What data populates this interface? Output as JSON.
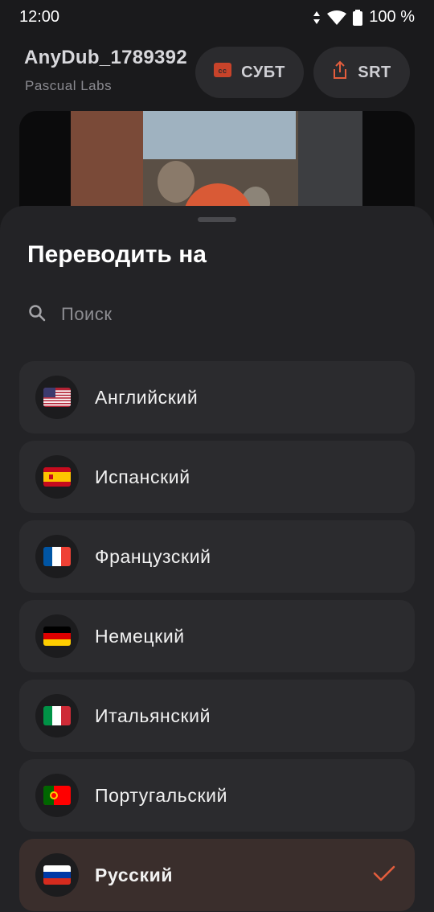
{
  "status_bar": {
    "time": "12:00",
    "battery": "100 %"
  },
  "header": {
    "title": "AnyDub_1789392",
    "subtitle": "Pascual Labs"
  },
  "toolbar": {
    "subtitles_label": "СУБТ",
    "srt_label": "SRT"
  },
  "sheet": {
    "title": "Переводить на",
    "search_placeholder": "Поиск",
    "languages": [
      {
        "label": "Английский",
        "flag": "us-flag-icon"
      },
      {
        "label": "Испанский",
        "flag": "es-flag-icon"
      },
      {
        "label": "Французский",
        "flag": "fr-flag-icon"
      },
      {
        "label": "Немецкий",
        "flag": "de-flag-icon"
      },
      {
        "label": "Итальянский",
        "flag": "it-flag-icon"
      },
      {
        "label": "Португальский",
        "flag": "pt-flag-icon"
      },
      {
        "label": "Русский",
        "flag": "ru-flag-icon",
        "selected": true
      }
    ]
  },
  "colors": {
    "accent": "#e35d3d",
    "sheet_bg": "#232326",
    "item_bg": "#2b2b2e",
    "selected_bg": "#3a2e2c"
  }
}
